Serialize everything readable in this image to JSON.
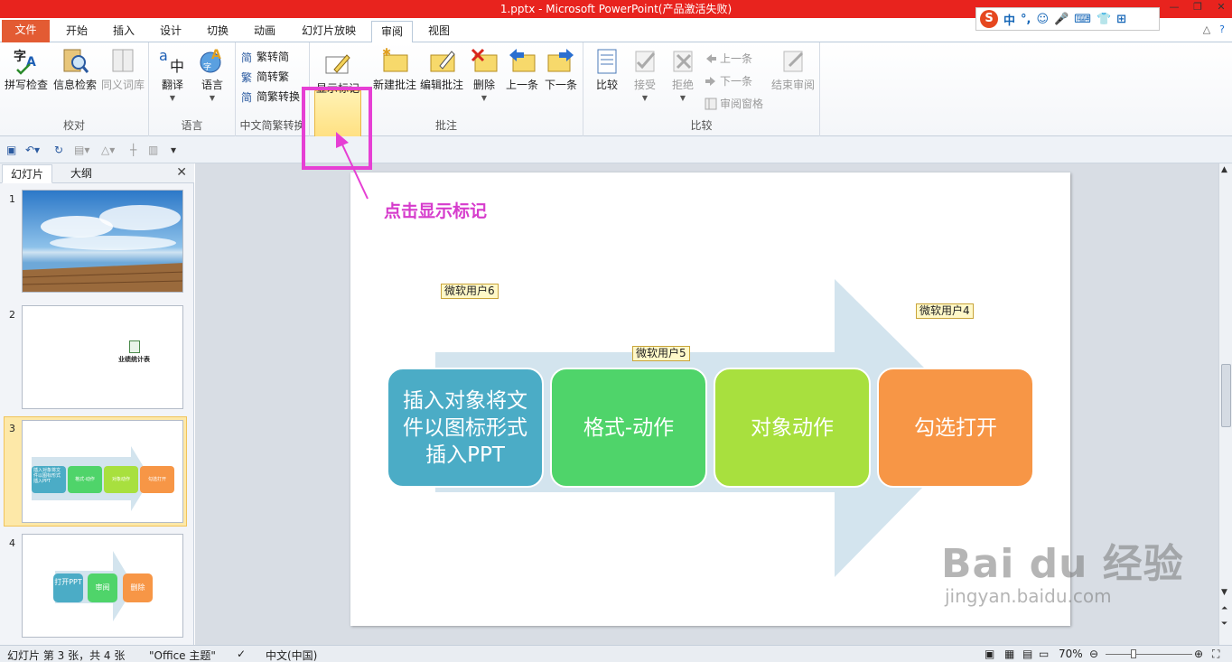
{
  "window": {
    "title": "1.pptx - Microsoft PowerPoint(产品激活失败)",
    "controls": [
      "—",
      "❐",
      "✕"
    ]
  },
  "ime_bar": {
    "logo": "S",
    "items": [
      "中",
      "°,",
      "☺",
      "🎤",
      "⌨",
      "👕",
      "⊞"
    ]
  },
  "tabs": [
    "文件",
    "开始",
    "插入",
    "设计",
    "切换",
    "动画",
    "幻灯片放映",
    "审阅",
    "视图"
  ],
  "active_tab": "审阅",
  "ribbon": {
    "groups": {
      "proofing": {
        "label": "校对",
        "buttons": [
          "拼写检查",
          "信息检索",
          "同义词库"
        ]
      },
      "language": {
        "label": "语言",
        "buttons": [
          "翻译",
          "语言"
        ]
      },
      "chinese": {
        "label": "中文简繁转换",
        "buttons": [
          "繁转简",
          "简转繁",
          "简繁转换"
        ]
      },
      "comments": {
        "label": "批注",
        "buttons": [
          "显示标记",
          "新建批注",
          "编辑批注",
          "删除",
          "上一条",
          "下一条"
        ]
      },
      "compare": {
        "label": "比较",
        "buttons": [
          "比较",
          "接受",
          "拒绝",
          "上一条",
          "下一条",
          "审阅窗格",
          "结束审阅"
        ]
      }
    }
  },
  "pane": {
    "tabs": [
      "幻灯片",
      "大纲"
    ],
    "close": "✕"
  },
  "thumbnails": [
    {
      "num": "1"
    },
    {
      "num": "2",
      "caption": "业绩统计表"
    },
    {
      "num": "3",
      "boxes": [
        "插入对象将文件以图标形式插入PPT",
        "格式-动作",
        "对象动作",
        "勾选打开"
      ]
    },
    {
      "num": "4",
      "boxes": [
        "打开PPT",
        "审阅",
        "删除"
      ]
    }
  ],
  "selected_slide": 3,
  "slide": {
    "boxes": [
      {
        "text": "插入对象将文件以图标形式插入PPT",
        "color": "#4bacc6"
      },
      {
        "text": "格式-动作",
        "color": "#4fd46a"
      },
      {
        "text": "对象动作",
        "color": "#a8e03e"
      },
      {
        "text": "勾选打开",
        "color": "#f79646"
      }
    ],
    "comments": [
      "微软用户6",
      "微软用户5",
      "微软用户4"
    ]
  },
  "annotation": {
    "text": "点击显示标记",
    "color": "#e63fd4"
  },
  "status": {
    "slide_info": "幻灯片 第 3 张，共 4 张",
    "theme": "\"Office 主题\"",
    "language": "中文(中国)",
    "zoom": "70%"
  },
  "watermark": {
    "brand": "Bai du 经验",
    "url": "jingyan.baidu.com"
  }
}
